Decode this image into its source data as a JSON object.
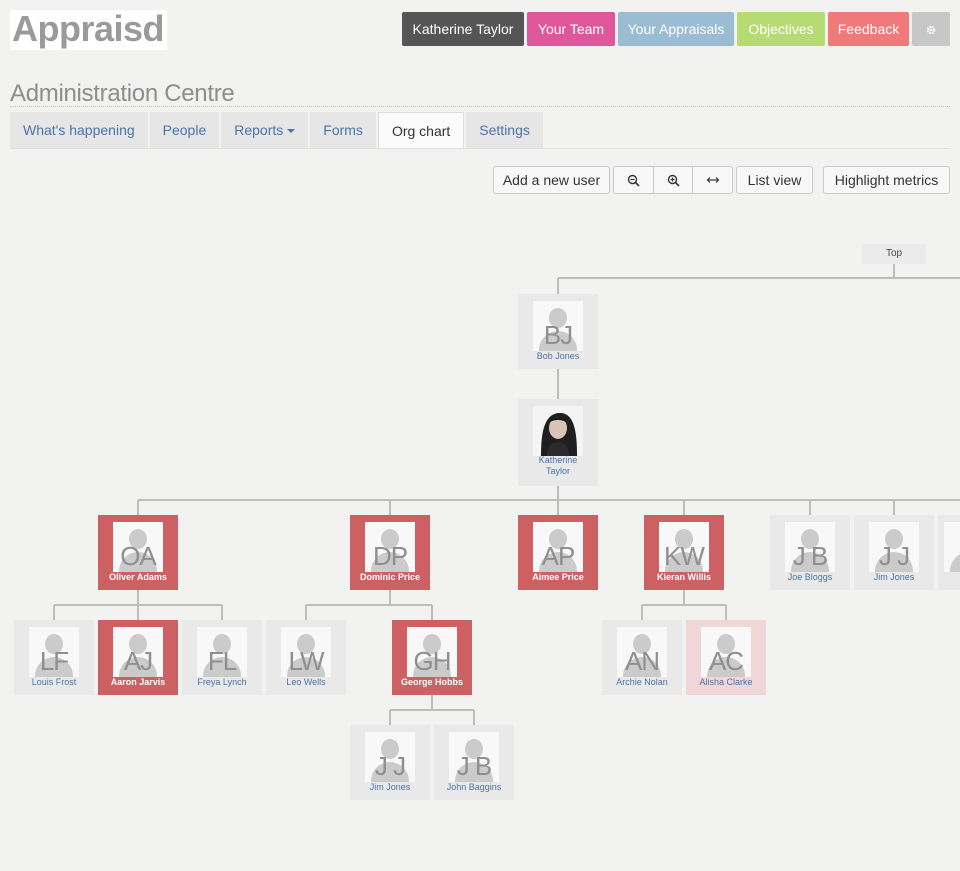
{
  "logo": "Appraisd",
  "topnav": {
    "user": "Katherine Taylor",
    "team": "Your Team",
    "appraisals": "Your Appraisals",
    "objectives": "Objectives",
    "feedback": "Feedback",
    "settings_icon": "gear-icon"
  },
  "page_title": "Administration Centre",
  "tabs": [
    {
      "label": "What's happening"
    },
    {
      "label": "People"
    },
    {
      "label": "Reports"
    },
    {
      "label": "Forms"
    },
    {
      "label": "Org chart"
    },
    {
      "label": "Settings"
    }
  ],
  "active_tab": "Org chart",
  "toolbar": {
    "add_user": "Add a new user",
    "zoom_out_icon": "zoom-out-icon",
    "zoom_in_icon": "zoom-in-icon",
    "fit_icon": "fit-width-icon",
    "list_view": "List view",
    "highlight": "Highlight metrics"
  },
  "org": {
    "top_label": "Top",
    "nodes": {
      "bob": {
        "initials": "BJ",
        "name": "Bob Jones"
      },
      "katherine": {
        "name_line1": "Katherine",
        "name_line2": "Taylor"
      },
      "oliver": {
        "initials": "OA",
        "name": "Oliver Adams"
      },
      "dominic": {
        "initials": "DP",
        "name": "Dominic Price"
      },
      "aimee": {
        "initials": "AP",
        "name": "Aimee Price"
      },
      "kieran": {
        "initials": "KW",
        "name": "Kieran Willis"
      },
      "joe": {
        "initials": "J B",
        "name": "Joe Bloggs"
      },
      "jim1": {
        "initials": "J J",
        "name": "Jim Jones"
      },
      "louis": {
        "initials": "LF",
        "name": "Louis Frost"
      },
      "aaron": {
        "initials": "AJ",
        "name": "Aaron Jarvis"
      },
      "freya": {
        "initials": "FL",
        "name": "Freya Lynch"
      },
      "leo": {
        "initials": "LW",
        "name": "Leo Wells"
      },
      "george": {
        "initials": "GH",
        "name": "George Hobbs"
      },
      "archie": {
        "initials": "AN",
        "name": "Archie Nolan"
      },
      "alisha": {
        "initials": "AC",
        "name": "Alisha Clarke"
      },
      "jim2": {
        "initials": "J J",
        "name": "Jim Jones"
      },
      "john": {
        "initials": "J B",
        "name": "John Baggins"
      }
    }
  },
  "colors": {
    "highlight_red": "#cd6062",
    "highlight_pink": "#f0d6d6",
    "link_blue": "#4b74a8"
  }
}
